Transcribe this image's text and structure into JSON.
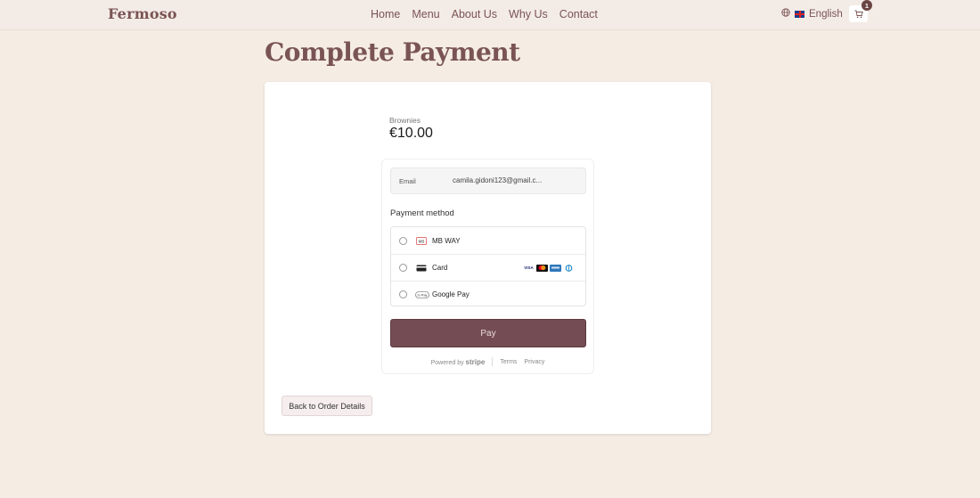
{
  "header": {
    "brand": "Fermoso",
    "nav": [
      "Home",
      "Menu",
      "About Us",
      "Why Us",
      "Contact"
    ],
    "language": "English",
    "cart_count": "1"
  },
  "page": {
    "title": "Complete Payment"
  },
  "payment": {
    "product_name": "Brownies",
    "price": "€10.00",
    "email_label": "Email",
    "email_value": "camila.gidoni123@gmail.c...",
    "method_title": "Payment method",
    "methods": [
      {
        "label": "MB WAY",
        "icon": "mbway-icon"
      },
      {
        "label": "Card",
        "icon": "card-icon"
      },
      {
        "label": "Google Pay",
        "icon": "google-pay-icon"
      }
    ],
    "card_brands": [
      "VISA",
      "mastercard",
      "amex",
      "diners"
    ],
    "pay_label": "Pay",
    "powered_by": "Powered by",
    "stripe": "stripe",
    "terms": "Terms",
    "privacy": "Privacy"
  },
  "actions": {
    "back_label": "Back to Order Details"
  },
  "colors": {
    "background": "#f5ede4",
    "accent": "#7a5454",
    "pay_button": "#744c53"
  }
}
